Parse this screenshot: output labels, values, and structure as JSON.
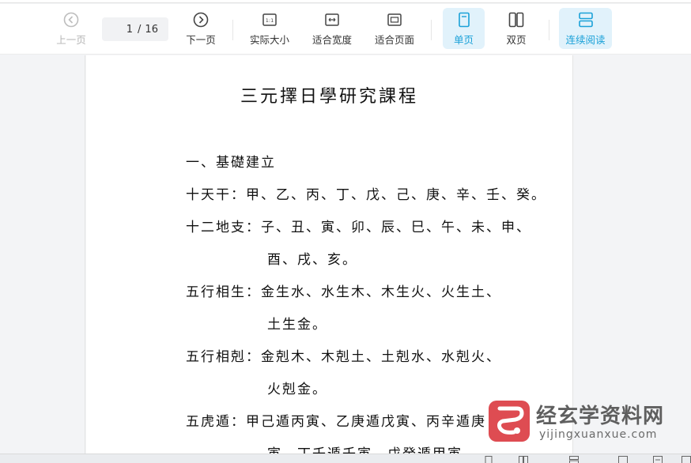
{
  "toolbar": {
    "prev_label": "上一页",
    "page_current": "1",
    "page_total": "16",
    "next_label": "下一页",
    "actual_size_label": "实际大小",
    "fit_width_label": "适合宽度",
    "fit_page_label": "适合页面",
    "single_page_label": "单页",
    "double_page_label": "双页",
    "continuous_label": "连续阅读"
  },
  "document": {
    "title": "三元擇日學研究課程",
    "lines": [
      "一、基礎建立",
      "十天干：甲、乙、丙、丁、戊、己、庚、辛、壬、癸。",
      "十二地支：子、丑、寅、卯、辰、巳、午、未、申、",
      "酉、戌、亥。",
      "五行相生：金生水、水生木、木生火、火生土、",
      "土生金。",
      "五行相剋：金剋木、木剋土、土剋水、水剋火、",
      "火剋金。",
      "五虎遁：甲己遁丙寅、乙庚遁戊寅、丙辛遁庚",
      "寅、丁壬遁壬寅、戊癸遁甲寅。"
    ]
  },
  "watermark": {
    "title": "经玄学资料网",
    "url": "yijingxuanxue.com"
  },
  "colors": {
    "accent": "#1aa1d8",
    "active_bg": "#e1f2fb",
    "logo_red": "#d9333a"
  }
}
